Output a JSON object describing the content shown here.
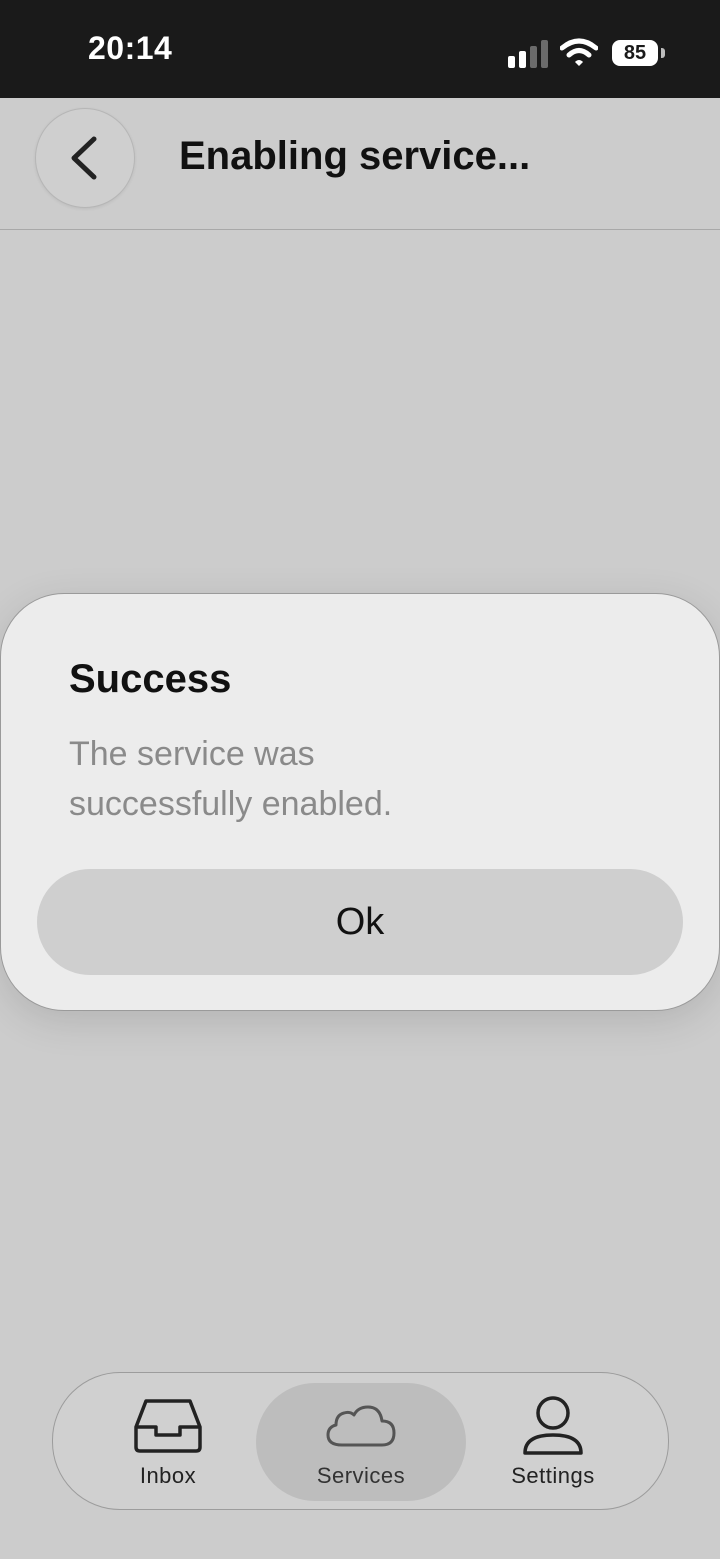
{
  "status_bar": {
    "time": "20:14",
    "battery_level": "85",
    "icons": [
      "signal-icon",
      "wifi-icon",
      "battery-icon"
    ]
  },
  "header": {
    "back_icon": "chevron-left-icon",
    "title": "Enabling service..."
  },
  "alert": {
    "title": "Success",
    "message": "The service was successfully enabled.",
    "ok_label": "Ok"
  },
  "tab_bar": {
    "active_tab": "Services",
    "tabs": [
      {
        "label": "Inbox",
        "icon": "inbox-tray-icon"
      },
      {
        "label": "Services",
        "icon": "cloud-icon"
      },
      {
        "label": "Settings",
        "icon": "person-icon"
      }
    ]
  },
  "colors": {
    "background": "#cccccc",
    "status_bar": "#1a1a1a",
    "card": "#ececec",
    "button": "#cfcfcf",
    "message_text": "#8a8a8a"
  }
}
